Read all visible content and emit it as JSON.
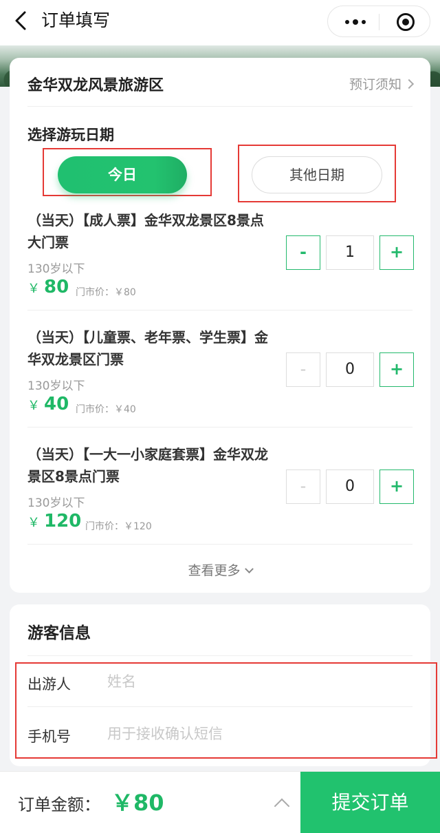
{
  "header": {
    "title": "订单填写"
  },
  "scenic": {
    "name": "金华双龙风景旅游区",
    "notice_link": "预订须知"
  },
  "date": {
    "label": "选择游玩日期",
    "today": "今日",
    "other": "其他日期"
  },
  "tickets": [
    {
      "name": "（当天）【成人票】金华双龙景区8景点大门票",
      "age": "130岁以下",
      "yen": "￥",
      "price": "80",
      "market": "门市价：￥80",
      "quantity": "1",
      "minus": "-",
      "plus": "+"
    },
    {
      "name": "（当天）【儿童票、老年票、学生票】金华双龙景区门票",
      "age": "130岁以下",
      "yen": "￥",
      "price": "40",
      "market": "门市价：￥40",
      "quantity": "0",
      "minus": "-",
      "plus": "+"
    },
    {
      "name": "（当天）【一大一小家庭套票】金华双龙景区8景点门票",
      "age": "130岁以下",
      "yen": "￥",
      "price": "120",
      "market": "门市价：￥120",
      "quantity": "0",
      "minus": "-",
      "plus": "+"
    }
  ],
  "view_more": "查看更多",
  "visitor": {
    "title": "游客信息",
    "traveler_label": "出游人",
    "traveler_placeholder": "姓名",
    "phone_label": "手机号",
    "phone_placeholder": "用于接收确认短信"
  },
  "bottom": {
    "total_label": "订单金额：",
    "total_value": "￥80",
    "submit": "提交订单"
  },
  "colors": {
    "accent": "#21c26e",
    "annotation": "#e53935"
  }
}
